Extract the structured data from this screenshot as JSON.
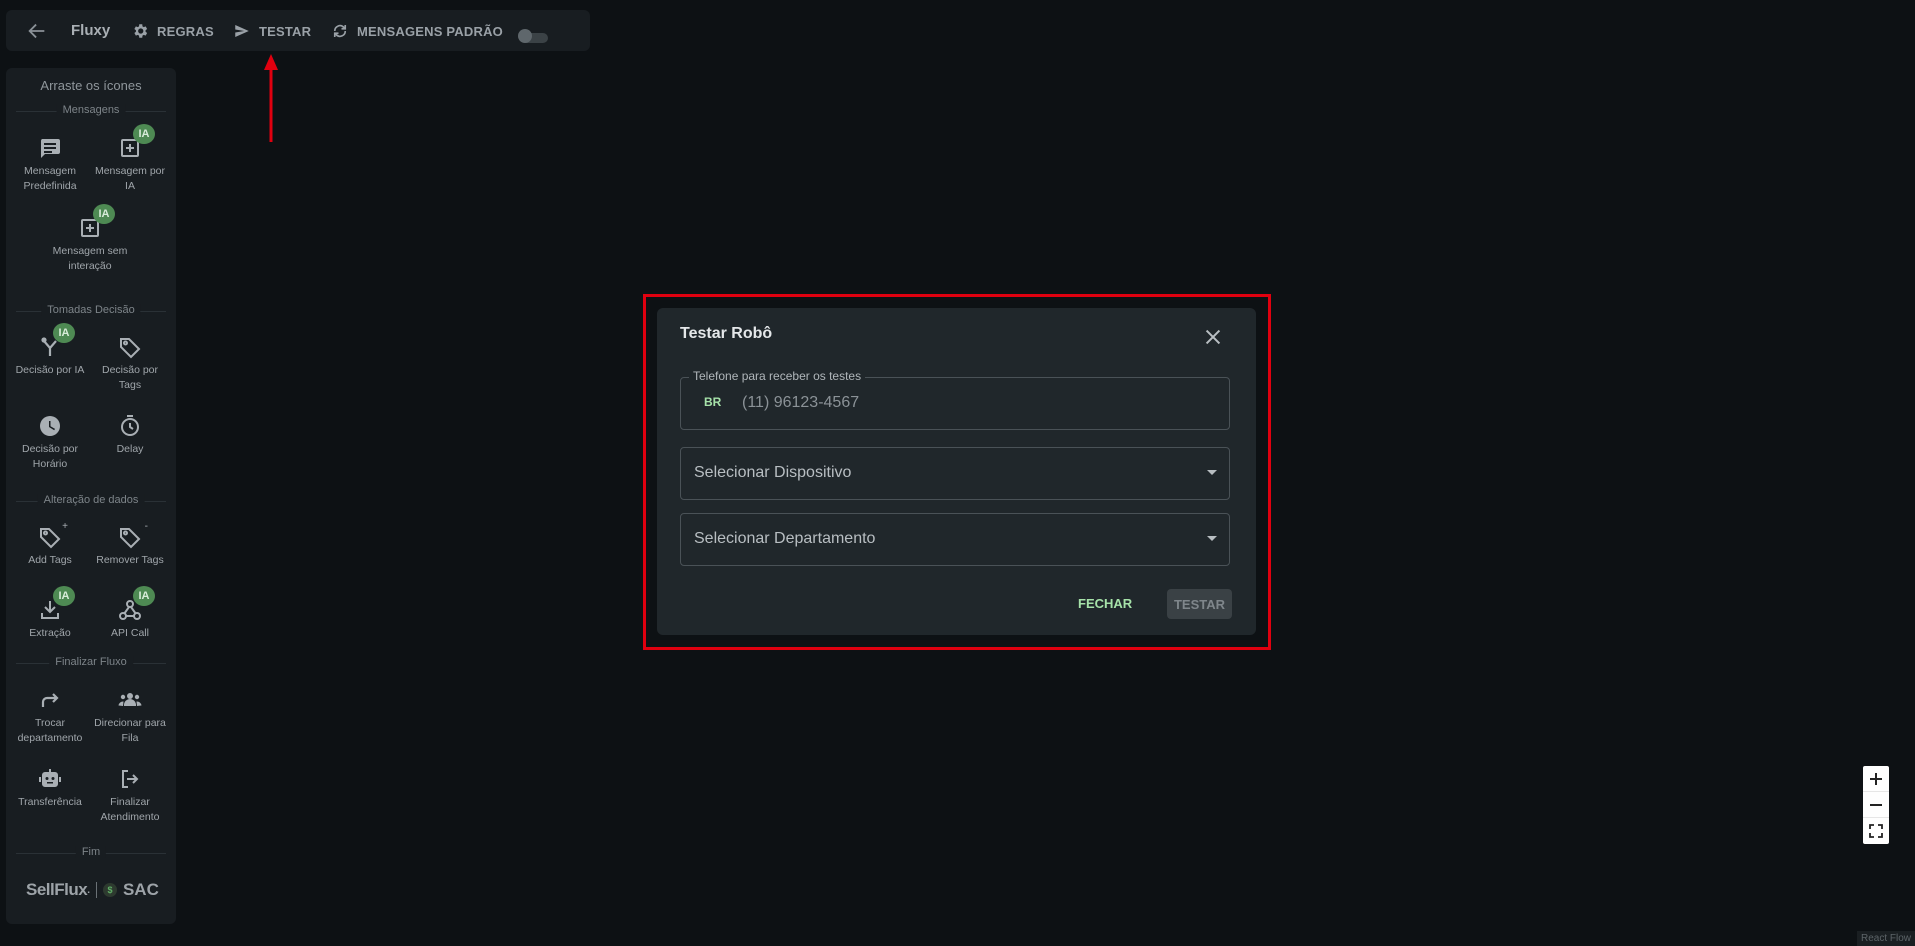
{
  "toolbar": {
    "title": "Fluxy",
    "rules_label": "REGRAS",
    "test_label": "TESTAR",
    "default_messages_label": "MENSAGENS PADRÃO"
  },
  "sidebar": {
    "heading": "Arraste os ícones",
    "badge": "IA",
    "sections": {
      "messages": "Mensagens",
      "decisions": "Tomadas Decisão",
      "data_change": "Alteração de dados",
      "finish_flow": "Finalizar Fluxo",
      "end": "Fim"
    },
    "items": {
      "predefined_message": "Mensagem Predefinida",
      "ai_message": "Mensagem por IA",
      "no_interaction_message": "Mensagem sem interação",
      "ai_decision": "Decisão por IA",
      "tag_decision": "Decisão por Tags",
      "time_decision": "Decisão por Horário",
      "delay": "Delay",
      "add_tags": "Add Tags",
      "remove_tags": "Remover Tags",
      "extraction": "Extração",
      "api_call": "API Call",
      "change_department": "Trocar departamento",
      "send_to_queue": "Direcionar para Fila",
      "transfer": "Transferência",
      "finish_service": "Finalizar Atendimento"
    },
    "brand": {
      "sellflux": "SellFlux",
      "dot": ".",
      "sac": "SAC"
    }
  },
  "modal": {
    "title": "Testar Robô",
    "phone_label": "Telefone para receber os testes",
    "country_code": "BR",
    "phone_value": "(11) 96123-4567",
    "device_select": "Selecionar Dispositivo",
    "department_select": "Selecionar Departamento",
    "close_button": "FECHAR",
    "test_button": "TESTAR"
  },
  "attribution": "React Flow",
  "colors": {
    "accent_green": "#a6e2a9",
    "badge_green": "#4e8a53",
    "highlight_red": "#e0000f"
  }
}
